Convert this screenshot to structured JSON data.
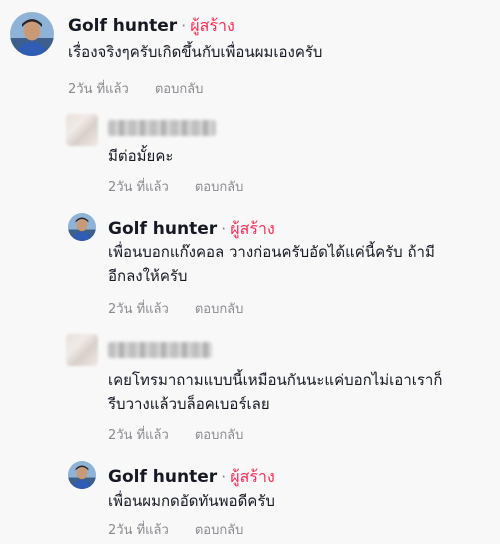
{
  "comments": [
    {
      "author": "Golf hunter",
      "separator": "·",
      "badge": "ผู้สร้าง",
      "text_lines": [
        "เรื่องจริงๆครับเกิดขึ้นกับเพื่อนผมเองครับ"
      ],
      "time": "2วัน ที่แล้ว",
      "reply": "ตอบกลับ"
    },
    {
      "author": "",
      "text_lines": [
        "มีต่อมั้ยคะ"
      ],
      "time": "2วัน ที่แล้ว",
      "reply": "ตอบกลับ"
    },
    {
      "author": "Golf hunter",
      "separator": "·",
      "badge": "ผู้สร้าง",
      "text_lines": [
        "เพื่อนบอกแก๊งคอล วางก่อนครับอัดได้แค่นี้ครับ ถ้ามี",
        "อีกลงให้ครับ"
      ],
      "time": "2วัน ที่แล้ว",
      "reply": "ตอบกลับ"
    },
    {
      "author": "",
      "text_lines": [
        "เคยโทรมาถามแบบนี้เหมือนกันนะแค่บอกไม่เอาเราก็",
        "รีบวางแล้วบล็อคเบอร์เลย"
      ],
      "time": "2วัน ที่แล้ว",
      "reply": "ตอบกลับ"
    },
    {
      "author": "Golf hunter",
      "separator": "·",
      "badge": "ผู้สร้าง",
      "text_lines": [
        "เพื่อนผมกดอัดทันพอดีครับ"
      ],
      "time": "2วัน ที่แล้ว",
      "reply": "ตอบกลับ"
    }
  ]
}
